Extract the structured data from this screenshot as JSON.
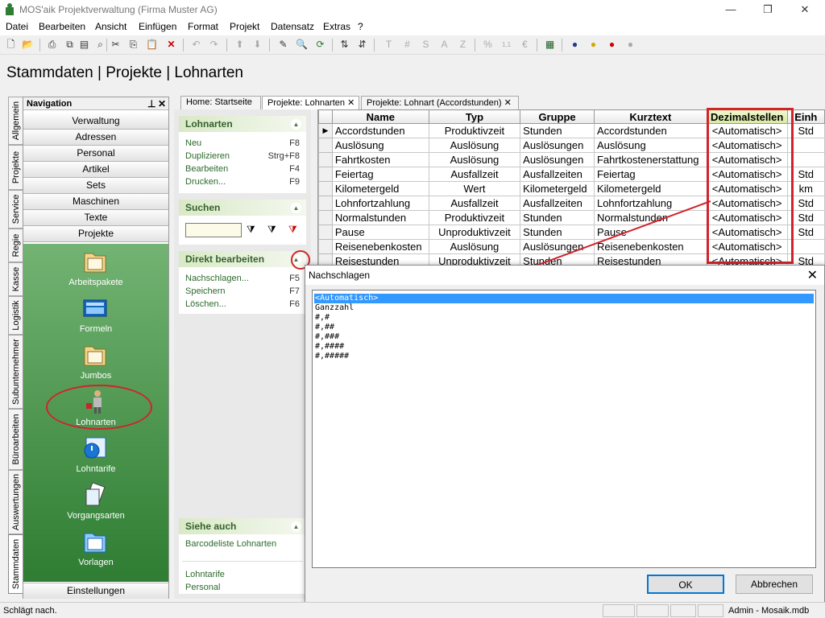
{
  "window": {
    "title": "MOS'aik Projektverwaltung (Firma Muster AG)"
  },
  "menu": [
    "Datei",
    "Bearbeiten",
    "Ansicht",
    "Einfügen",
    "Format",
    "Projekt",
    "Datensatz",
    "Extras",
    "?"
  ],
  "breadcrumb": "Stammdaten | Projekte | Lohnarten",
  "vertical_tabs": [
    "Allgemein",
    "Projekte",
    "Service",
    "Regie",
    "Kasse",
    "Logistik",
    "Subunternehmer",
    "Büroarbeiten",
    "Auswertungen",
    "Stammdaten"
  ],
  "navigation": {
    "title": "Navigation",
    "buttons": [
      "Verwaltung",
      "Adressen",
      "Personal",
      "Artikel",
      "Sets",
      "Maschinen",
      "Texte",
      "Projekte"
    ],
    "items": [
      "Arbeitspakete",
      "Formeln",
      "Jumbos",
      "Lohnarten",
      "Lohntarife",
      "Vorgangsarten",
      "Vorlagen"
    ],
    "footer": "Einstellungen"
  },
  "tasks": {
    "lohnarten": {
      "title": "Lohnarten",
      "items": [
        {
          "label": "Neu",
          "key": "F8"
        },
        {
          "label": "Duplizieren",
          "key": "Strg+F8"
        },
        {
          "label": "Bearbeiten",
          "key": "F4"
        },
        {
          "label": "Drucken...",
          "key": "F9"
        }
      ]
    },
    "suchen": {
      "title": "Suchen"
    },
    "direkt": {
      "title": "Direkt bearbeiten",
      "items": [
        {
          "label": "Nachschlagen...",
          "key": "F5"
        },
        {
          "label": "Speichern",
          "key": "F7"
        },
        {
          "label": "Löschen...",
          "key": "F6"
        }
      ]
    },
    "siehe": {
      "title": "Siehe auch",
      "items": [
        "Barcodeliste Lohnarten",
        "Lohntarife",
        "Personal"
      ]
    }
  },
  "tabs": [
    {
      "label": "Home: Startseite",
      "close": ""
    },
    {
      "label": "Projekte: Lohnarten",
      "close": "✕"
    },
    {
      "label": "Projekte: Lohnart (Accordstunden)",
      "close": "✕"
    }
  ],
  "table": {
    "columns": [
      "Name",
      "Typ",
      "Gruppe",
      "Kurztext",
      "Dezimalstellen",
      "Einh"
    ],
    "rows": [
      [
        "Accordstunden",
        "Produktivzeit",
        "Stunden",
        "Accordstunden",
        "<Automatisch>",
        "Std"
      ],
      [
        "Auslösung",
        "Auslösung",
        "Auslösungen",
        "Auslösung",
        "<Automatisch>",
        ""
      ],
      [
        "Fahrtkosten",
        "Auslösung",
        "Auslösungen",
        "Fahrtkostenerstattung",
        "<Automatisch>",
        ""
      ],
      [
        "Feiertag",
        "Ausfallzeit",
        "Ausfallzeiten",
        "Feiertag",
        "<Automatisch>",
        "Std"
      ],
      [
        "Kilometergeld",
        "Wert",
        "Kilometergeld",
        "Kilometergeld",
        "<Automatisch>",
        "km"
      ],
      [
        "Lohnfortzahlung",
        "Ausfallzeit",
        "Ausfallzeiten",
        "Lohnfortzahlung",
        "<Automatisch>",
        "Std"
      ],
      [
        "Normalstunden",
        "Produktivzeit",
        "Stunden",
        "Normalstunden",
        "<Automatisch>",
        "Std"
      ],
      [
        "Pause",
        "Unproduktivzeit",
        "Stunden",
        "Pause",
        "<Automatisch>",
        "Std"
      ],
      [
        "Reisenebenkosten",
        "Auslösung",
        "Auslösungen",
        "Reisenebenkosten",
        "<Automatisch>",
        ""
      ],
      [
        "Reisestunden",
        "Unproduktivzeit",
        "Stunden",
        "Reisestunden",
        "<Automatisch>",
        "Std"
      ]
    ]
  },
  "dialog": {
    "title": "Nachschlagen",
    "options": [
      "<Automatisch>",
      "Ganzzahl",
      "#,#",
      "#,##",
      "#,###",
      "#,####",
      "#,#####"
    ],
    "selected": 0,
    "ok": "OK",
    "cancel": "Abbrechen"
  },
  "status": {
    "left": "Schlägt nach.",
    "right": "Admin - Mosaik.mdb"
  },
  "colors": {
    "accent_red": "#d0242a",
    "nav_green": "#2e7d32",
    "selection": "#3399ff"
  }
}
